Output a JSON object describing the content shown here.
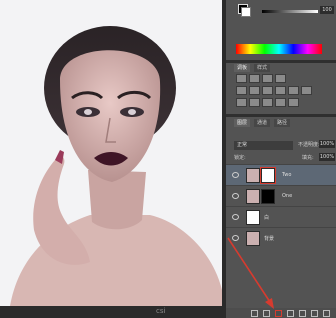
{
  "color_panel": {
    "slider_value": "100"
  },
  "panel_tabs": {
    "swatches": [
      "调板",
      "样式"
    ],
    "layers": [
      "图层",
      "通道",
      "路径"
    ]
  },
  "layers_panel": {
    "blend_mode": "正常",
    "opacity_label": "不透明度:",
    "opacity_value": "100%",
    "lock_label": "锁定:",
    "fill_label": "填充:",
    "fill_value": "100%",
    "layers": [
      {
        "name": "Two",
        "selected": true
      },
      {
        "name": "One",
        "selected": false
      },
      {
        "name": "白",
        "selected": false
      },
      {
        "name": "背景",
        "selected": false
      }
    ]
  },
  "watermark": "csi",
  "colors": {
    "accent_arrow": "#d63b2f",
    "selection": "#5d6875"
  },
  "icons": [
    "link-icon",
    "fx-icon",
    "mask-icon",
    "adjustment-icon",
    "group-icon",
    "new-layer-icon",
    "trash-icon"
  ]
}
